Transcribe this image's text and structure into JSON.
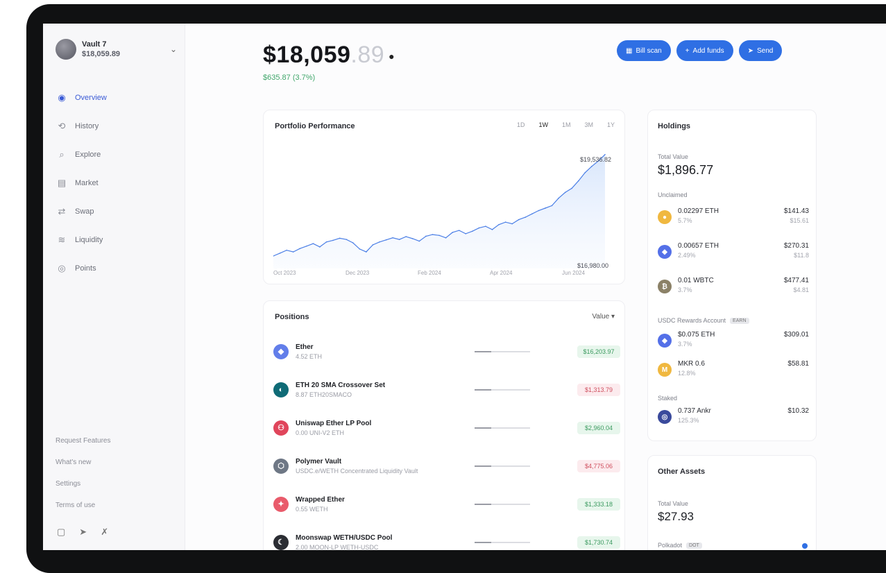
{
  "account": {
    "name": "Vault 7",
    "value": "$18,059.89"
  },
  "nav": [
    {
      "label": "Overview",
      "icon": "overview-icon",
      "glyph": "◉",
      "active": true
    },
    {
      "label": "History",
      "icon": "history-icon",
      "glyph": "⟲",
      "active": false
    },
    {
      "label": "Explore",
      "icon": "explore-icon",
      "glyph": "⌕",
      "active": false
    },
    {
      "label": "Market",
      "icon": "market-icon",
      "glyph": "▤",
      "active": false
    },
    {
      "label": "Swap",
      "icon": "swap-icon",
      "glyph": "⇄",
      "active": false
    },
    {
      "label": "Liquidity",
      "icon": "liquidity-icon",
      "glyph": "≋",
      "active": false
    },
    {
      "label": "Points",
      "icon": "points-icon",
      "glyph": "◎",
      "active": false
    }
  ],
  "side_links": [
    "Request Features",
    "What's new",
    "Settings",
    "Terms of use"
  ],
  "balance": {
    "whole": "$18,059",
    "cents": ".89",
    "change": "$635.87 (3.7%)"
  },
  "actions": [
    {
      "label": "Bill scan",
      "glyph": "▦",
      "name": "bill-scan-button"
    },
    {
      "label": "Add funds",
      "glyph": "+",
      "name": "add-funds-button"
    },
    {
      "label": "Send",
      "glyph": "➤",
      "name": "send-button"
    }
  ],
  "performance": {
    "title": "Portfolio Performance",
    "ranges": [
      "1D",
      "1W",
      "1M",
      "3M",
      "1Y"
    ],
    "selected_range": 1,
    "high_label": "$19,536.82",
    "low_label": "$16,980.00",
    "x_ticks": [
      "Oct 2023",
      "Dec 2023",
      "Feb 2024",
      "Apr 2024",
      "Jun 2024"
    ]
  },
  "chart_data": {
    "type": "area",
    "x": [
      "Oct 2023",
      "Dec 2023",
      "Feb 2024",
      "Apr 2024",
      "Jun 2024"
    ],
    "series": [
      {
        "values": [
          17080,
          17150,
          17220,
          17180,
          17260,
          17320,
          17380,
          17300,
          17420,
          17460,
          17510,
          17480,
          17400,
          17250,
          17180,
          17350,
          17420,
          17470,
          17520,
          17480,
          17550,
          17500,
          17440,
          17560,
          17600,
          17580,
          17520,
          17650,
          17700,
          17620,
          17680,
          17760,
          17800,
          17720,
          17840,
          17900,
          17860,
          17960,
          18020,
          18100,
          18180,
          18240,
          18300,
          18480,
          18620,
          18720,
          18900,
          19100,
          19250,
          19380,
          19536
        ]
      }
    ],
    "ylim": [
      16980,
      19600
    ]
  },
  "positions": {
    "title": "Positions",
    "sort_label": "Value ▾",
    "rows": [
      {
        "name": "Ether",
        "sub": "4.52 ETH",
        "value": "$16,203.97",
        "tone": "green",
        "color": "#627eea",
        "glyph": "◆",
        "icon": "ether-icon"
      },
      {
        "name": "ETH 20 SMA Crossover Set",
        "sub": "8.87 ETH20SMACO",
        "value": "$1,313.79",
        "tone": "red",
        "color": "#0f6b76",
        "glyph": "◐",
        "icon": "eth-sma-set-icon"
      },
      {
        "name": "Uniswap Ether LP Pool",
        "sub": "0.00 UNI-V2 ETH",
        "value": "$2,960.04",
        "tone": "green",
        "color": "#e0455b",
        "glyph": "⚇",
        "icon": "uniswap-icon"
      },
      {
        "name": "Polymer Vault",
        "sub": "USDC.e/WETH Concentrated Liquidity Vault",
        "value": "$4,775.06",
        "tone": "red",
        "color": "#6e7785",
        "glyph": "⬡",
        "icon": "polymer-vault-icon"
      },
      {
        "name": "Wrapped Ether",
        "sub": "0.55 WETH",
        "value": "$1,333.18",
        "tone": "green",
        "color": "#e95b6b",
        "glyph": "✦",
        "icon": "wrapped-ether-icon"
      },
      {
        "name": "Moonswap WETH/USDC Pool",
        "sub": "2.00 MOON-LP WETH-USDC",
        "value": "$1,730.74",
        "tone": "green",
        "color": "#2b2d33",
        "glyph": "☾",
        "icon": "moonswap-icon"
      }
    ]
  },
  "holdings": {
    "title": "Holdings",
    "total_label": "Total Value",
    "total_value": "$1,896.77",
    "group_label": "Unclaimed",
    "items": [
      {
        "name": "0.02297 ETH",
        "sub": "5.7%",
        "value": "$141.43",
        "value_sub": "$15.61",
        "color": "#f0b840",
        "glyph": "●",
        "icon": "eth-gold-icon"
      },
      {
        "name": "0.00657 ETH",
        "sub": "2.49%",
        "value": "$270.31",
        "value_sub": "$11.8",
        "color": "#5470e8",
        "glyph": "◆",
        "icon": "eth-blue-icon"
      },
      {
        "name": "0.01 WBTC",
        "sub": "3.7%",
        "value": "$477.41",
        "value_sub": "$4.81",
        "color": "#8b8167",
        "glyph": "₿",
        "icon": "wbtc-icon"
      }
    ],
    "group2_label": "USDC Rewards Account",
    "group2_tag": "EARN",
    "items2": [
      {
        "name": "$0.075 ETH",
        "sub": "3.7%",
        "value": "$309.01",
        "color": "#5470e8",
        "glyph": "◆",
        "icon": "eth-rewards-icon"
      },
      {
        "name": "MKR 0.6",
        "sub": "12.8%",
        "value": "$58.81",
        "color": "#f0b840",
        "glyph": "M",
        "icon": "mkr-icon"
      }
    ],
    "group3_label": "Staked",
    "items3": [
      {
        "name": "0.737 Ankr",
        "sub": "125.3%",
        "value": "$10.32",
        "color": "#3a4a9c",
        "glyph": "◎",
        "icon": "ankr-icon"
      }
    ]
  },
  "other_assets": {
    "title": "Other Assets",
    "total_label": "Total Value",
    "total_value": "$27.93",
    "row_label": "Polkadot",
    "row_tag": "DOT"
  }
}
